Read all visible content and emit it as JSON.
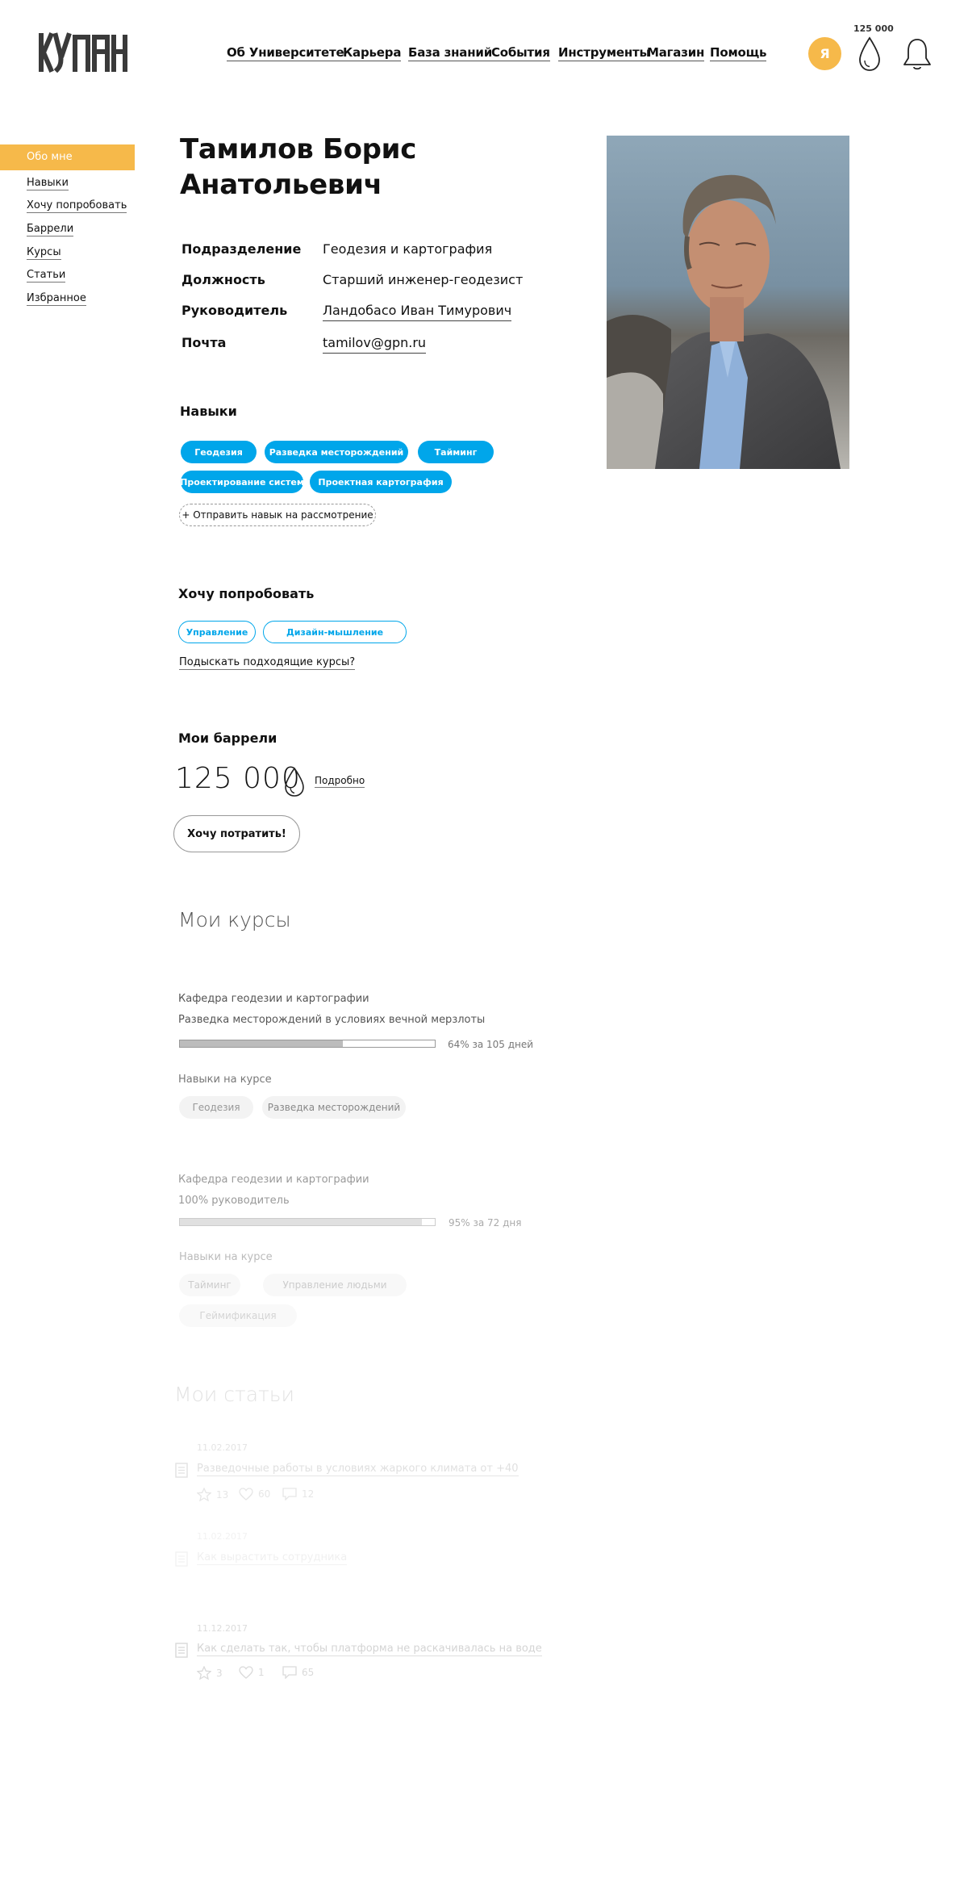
{
  "header": {
    "logo_alt": "КУГПН",
    "nav": [
      "Об Университете",
      "Карьера",
      "База знаний",
      "События",
      "Инструменты",
      "Магазин",
      "Помощь"
    ],
    "avatar_letter": "Я",
    "balance": "125 000"
  },
  "sidebar": {
    "items": [
      "Обо мне",
      "Навыки",
      "Хочу попробовать",
      "Баррели",
      "Курсы",
      "Статьи",
      "Избранное"
    ]
  },
  "profile": {
    "name_line1": "Тамилов Борис",
    "name_line2": "Анатольевич",
    "fields": [
      {
        "label": "Подразделение",
        "value": "Геодезия и картография"
      },
      {
        "label": "Должность",
        "value": "Старший инженер-геодезист"
      },
      {
        "label": "Руководитель",
        "value": "Ландобасо Иван Тимурович"
      },
      {
        "label": "Почта",
        "value": "tamilov@gpn.ru"
      }
    ]
  },
  "skills": {
    "title": "Навыки",
    "items": [
      "Геодезия",
      "Разведка месторождений",
      "Тайминг",
      "Проектирование систем",
      "Проектная картография"
    ],
    "submit_label": "+ Отправить навык на рассмотрение"
  },
  "want_to_try": {
    "title": "Хочу попробовать",
    "items": [
      "Управление",
      "Дизайн-мышление"
    ],
    "link": "Подыскать подходящие курсы?"
  },
  "barrels": {
    "title": "Мои баррели",
    "count": "125 000",
    "details_link": "Подробно",
    "spend_button": "Хочу потратить!"
  },
  "courses": {
    "title": "Мои курсы",
    "skills_label": "Навыки на курсе",
    "items": [
      {
        "department": "Кафедра геодезии и картографии",
        "name": "Разведка месторождений в условиях вечной мерзлоты",
        "progress": 0.64,
        "progress_text": "64% за 105 дней",
        "skills": [
          "Геодезия",
          "Разведка месторождений"
        ]
      },
      {
        "department": "Кафедра геодезии и картографии",
        "name": "100% руководитель",
        "progress": 0.95,
        "progress_text": "95% за  72 дня",
        "skills": [
          "Тайминг",
          "Управление людьми",
          "Геймификация"
        ]
      }
    ]
  },
  "articles": {
    "title": "Мои статьи",
    "items": [
      {
        "date": "11.02.2017",
        "title": "Разведочные работы в условиях жаркого климата от +40",
        "stars": "13",
        "likes": "60",
        "comments": "12"
      },
      {
        "date": "11.02.2017",
        "title": "Как вырастить сотрудника",
        "stars": "",
        "likes": "",
        "comments": ""
      },
      {
        "date": "11.12.2017",
        "title": "Как сделать так, чтобы платформа не раскачивалась на воде",
        "stars": "3",
        "likes": "1",
        "comments": "65"
      }
    ]
  }
}
